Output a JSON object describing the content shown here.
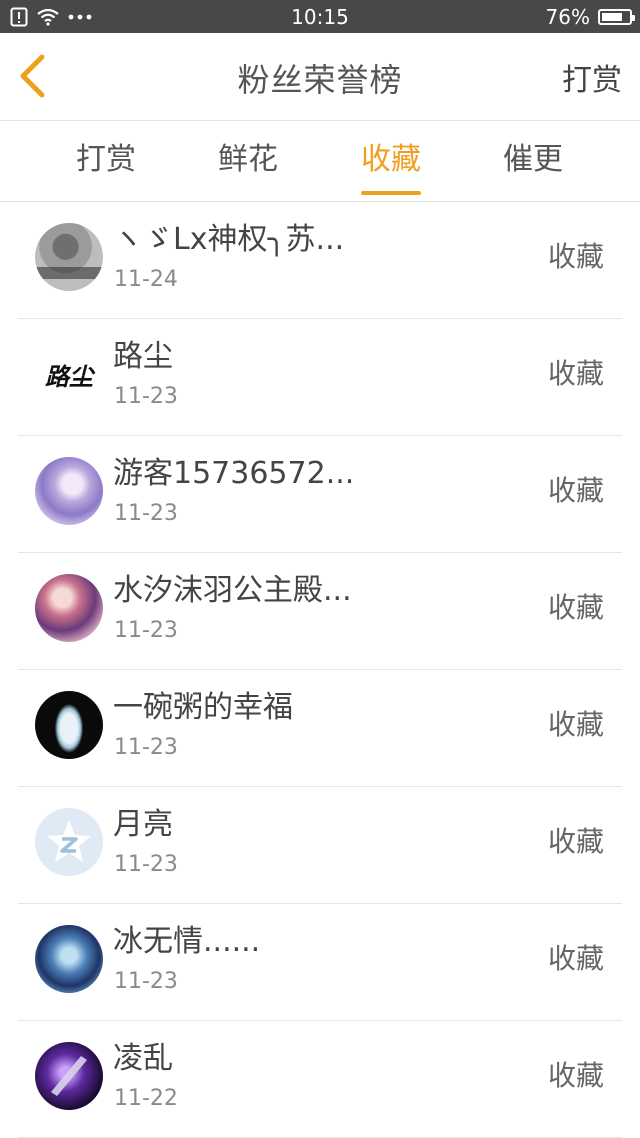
{
  "status_bar": {
    "time": "10:15",
    "battery": "76%",
    "battery_level": 0.76
  },
  "header": {
    "title": "粉丝荣誉榜",
    "action": "打赏"
  },
  "tabs": [
    {
      "label": "打赏",
      "active": false
    },
    {
      "label": "鲜花",
      "active": false
    },
    {
      "label": "收藏",
      "active": true
    },
    {
      "label": "催更",
      "active": false
    }
  ],
  "accent_color": "#f0a020",
  "fans": [
    {
      "name": "ヽゞLx神权╮苏...",
      "date": "11-24",
      "action": "收藏",
      "avatar": "photo-avatar"
    },
    {
      "name": "路尘",
      "date": "11-23",
      "action": "收藏",
      "avatar": "calligraphy-avatar",
      "avatar_text": "路尘"
    },
    {
      "name": "游客15736572...",
      "date": "11-23",
      "action": "收藏",
      "avatar": "anime-avatar"
    },
    {
      "name": "水汐沫羽公主殿...",
      "date": "11-23",
      "action": "收藏",
      "avatar": "anime-avatar"
    },
    {
      "name": "一碗粥的幸福",
      "date": "11-23",
      "action": "收藏",
      "avatar": "anime-avatar"
    },
    {
      "name": "月亮",
      "date": "11-23",
      "action": "收藏",
      "avatar": "default-star-avatar"
    },
    {
      "name": "冰无情......",
      "date": "11-23",
      "action": "收藏",
      "avatar": "anime-avatar"
    },
    {
      "name": "凌乱",
      "date": "11-22",
      "action": "收藏",
      "avatar": "sword-avatar"
    }
  ]
}
